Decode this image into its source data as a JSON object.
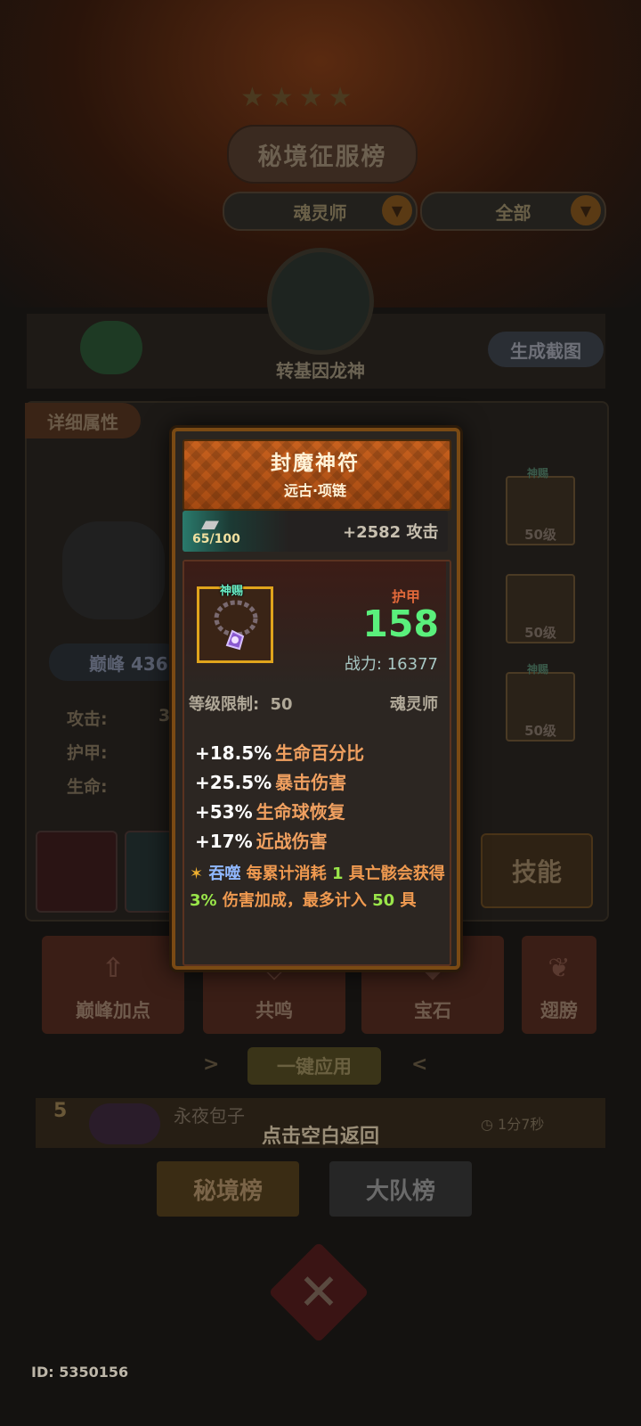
{
  "background": {
    "title": "秘境征服榜",
    "filter_class": "魂灵师",
    "filter_scope": "全部",
    "player_name": "转基因龙神",
    "generate_button": "生成截图",
    "detail_tab": "详细属性",
    "peak_label": "巅峰 436",
    "stats": {
      "attack": "攻击:",
      "attack_partial": "3",
      "armor": "护甲:",
      "life": "生命:"
    },
    "slots": [
      {
        "level": "50级",
        "tag": "神赐"
      },
      {
        "level": "50级",
        "tag": ""
      },
      {
        "level": "50级",
        "tag": "神赐"
      }
    ],
    "skill_button": "技能",
    "actions": [
      "巅峰加点",
      "共鸣",
      "宝石",
      "翅膀"
    ],
    "apply_button": "一键应用",
    "rank_row": {
      "rank": "5",
      "name": "永夜包子",
      "time": "1分7秒"
    },
    "hint": "点击空白返回",
    "tabs": [
      "秘境榜",
      "大队榜"
    ],
    "id_text": "ID: 5350156"
  },
  "item_card": {
    "name": "封魔神符",
    "subtitle": "远古·项链",
    "forge_progress": "65/100",
    "forge_bonus": "+2582 攻击",
    "item_tag": "神赐",
    "armor_label": "护甲",
    "armor_value": "158",
    "power_label": "战力:",
    "power_value": "16377",
    "level_req_label": "等级限制:",
    "level_req_value": "50",
    "class": "魂灵师",
    "attributes": [
      {
        "value": "+18.5%",
        "name": "生命百分比"
      },
      {
        "value": "+25.5%",
        "name": "暴击伤害"
      },
      {
        "value": "+53%",
        "name": "生命球恢复"
      },
      {
        "value": "+17%",
        "name": "近战伤害"
      }
    ],
    "special": {
      "star": "✶",
      "keyword": "吞噬",
      "p1": "每累计消耗",
      "n1": "1",
      "p2": "具亡骸会获得",
      "n2": "3%",
      "p3": "伤害加成，最多计入",
      "n3": "50",
      "p4": "具"
    }
  },
  "colors": {
    "card_border": "#7a4a14",
    "header_orange": "#c8611e",
    "armor_green": "#5af07c",
    "attr_name": "#f0a060",
    "item_frame": "#e0a41c"
  }
}
